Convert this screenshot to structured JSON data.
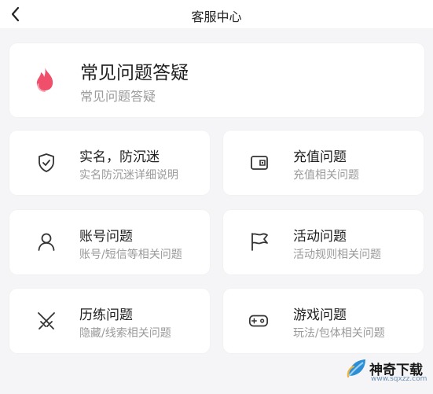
{
  "header": {
    "title": "客服中心",
    "back_icon": "chevron-left-icon"
  },
  "faq": {
    "title": "常见问题答疑",
    "subtitle": "常见问题答疑",
    "icon": "flame-icon",
    "icon_color": "#ef4f6a"
  },
  "categories": [
    {
      "title": "实名，防沉迷",
      "subtitle": "实名防沉迷详细说明",
      "icon": "shield-check-icon"
    },
    {
      "title": "充值问题",
      "subtitle": "充值相关问题",
      "icon": "wallet-icon"
    },
    {
      "title": "账号问题",
      "subtitle": "账号/短信等相关问题",
      "icon": "user-icon"
    },
    {
      "title": "活动问题",
      "subtitle": "活动规则相关问题",
      "icon": "flag-icon"
    },
    {
      "title": "历练问题",
      "subtitle": "隐藏/线索相关问题",
      "icon": "crossed-swords-icon"
    },
    {
      "title": "游戏问题",
      "subtitle": "玩法/包体相关问题",
      "icon": "gamepad-icon"
    }
  ],
  "watermark": {
    "text": "神奇下载",
    "url": "www.sqxzz.com",
    "icon": "leaf-logo-icon"
  }
}
